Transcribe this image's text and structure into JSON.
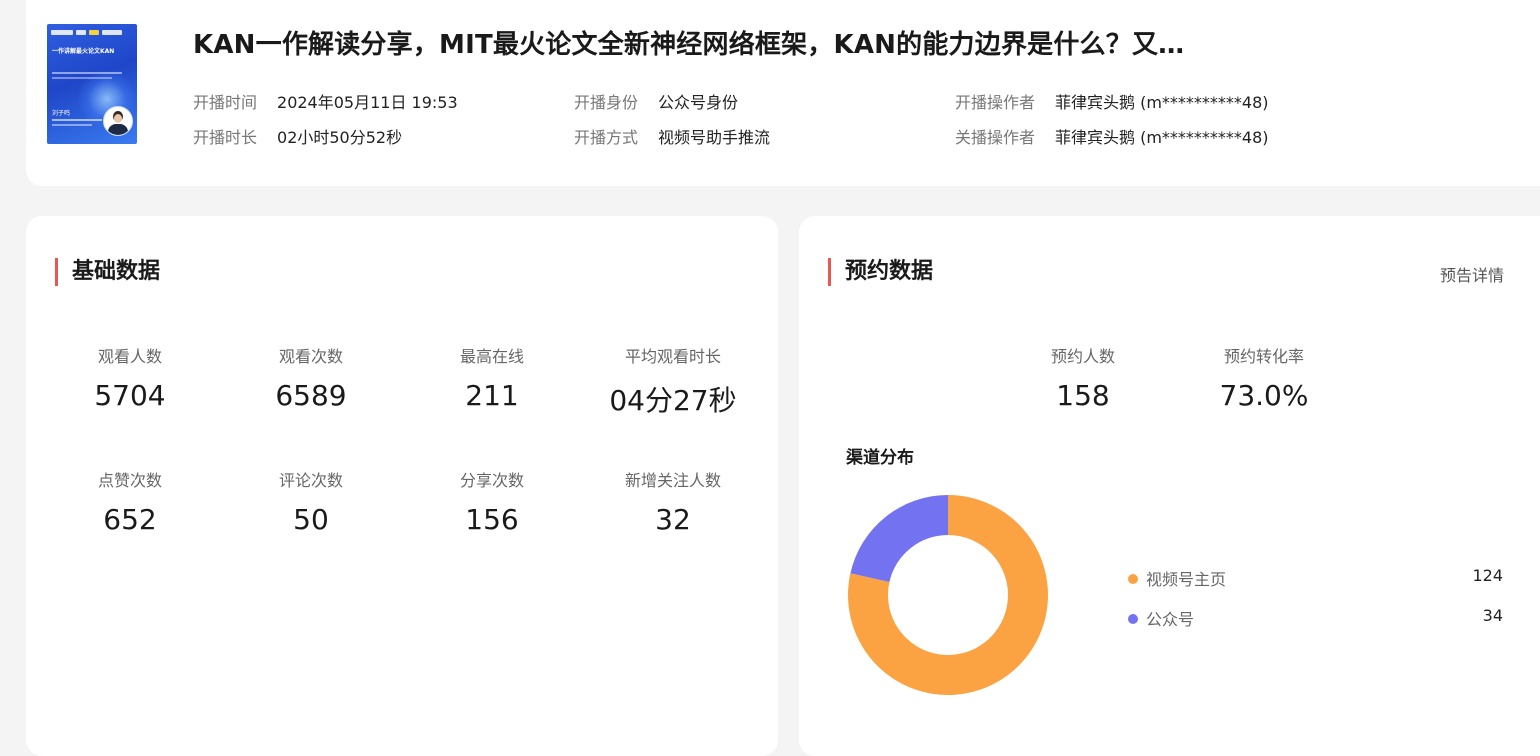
{
  "header": {
    "cover": {
      "title": "一作讲解最火论文KAN",
      "person_name": "刘子鸣"
    },
    "title": "KAN一作解读分享，MIT最火论文全新神经网络框架，KAN的能力边界是什么？又…",
    "meta": [
      {
        "label": "开播时间",
        "value": "2024年05月11日 19:53"
      },
      {
        "label": "开播时长",
        "value": "02小时50分52秒"
      },
      {
        "label": "开播身份",
        "value": "公众号身份"
      },
      {
        "label": "开播方式",
        "value": "视频号助手推流"
      },
      {
        "label": "开播操作者",
        "value": "菲律宾头鹅 (m**********48)"
      },
      {
        "label": "关播操作者",
        "value": "菲律宾头鹅 (m**********48)"
      }
    ]
  },
  "basic": {
    "title": "基础数据",
    "stats": [
      {
        "label": "观看人数",
        "value": "5704"
      },
      {
        "label": "观看次数",
        "value": "6589"
      },
      {
        "label": "最高在线",
        "value": "211"
      },
      {
        "label": "平均观看时长",
        "value": "04分27秒"
      },
      {
        "label": "点赞次数",
        "value": "652"
      },
      {
        "label": "评论次数",
        "value": "50"
      },
      {
        "label": "分享次数",
        "value": "156"
      },
      {
        "label": "新增关注人数",
        "value": "32"
      }
    ]
  },
  "reserve": {
    "title": "预约数据",
    "detail_link": "预告详情",
    "stats": [
      {
        "label": "预约人数",
        "value": "158"
      },
      {
        "label": "预约转化率",
        "value": "73.0%"
      }
    ],
    "channel_title": "渠道分布",
    "colors": {
      "accent": "#e8584e"
    }
  },
  "chart_data": {
    "type": "pie",
    "donut": true,
    "title": "渠道分布",
    "categories": [
      "视频号主页",
      "公众号"
    ],
    "values": [
      124,
      34
    ],
    "colors": [
      "#fba342",
      "#7373f2"
    ],
    "legend_position": "right"
  }
}
